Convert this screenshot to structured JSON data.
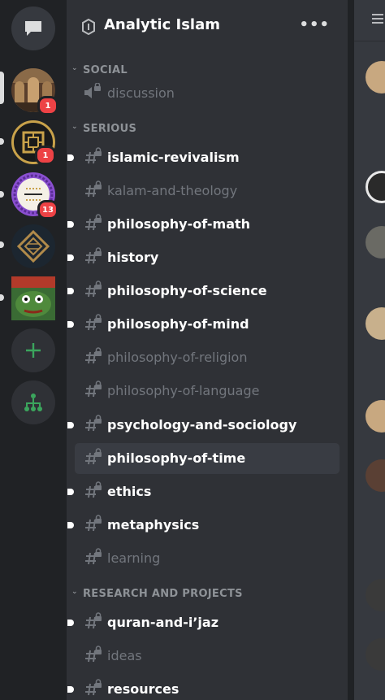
{
  "server": {
    "name": "Analytic Islam",
    "more_label": "•••"
  },
  "rail": {
    "badges": [
      "1",
      "1",
      "13"
    ],
    "icons": [
      "chat-bubble-icon",
      "add-server-icon",
      "explore-servers-icon"
    ]
  },
  "categories": [
    {
      "name": "SOCIAL"
    },
    {
      "name": "SERIOUS"
    },
    {
      "name": "RESEARCH AND PROJECTS"
    }
  ],
  "channels": [
    {
      "name": "discussion",
      "state": "muted",
      "icon": "speaker-lock-icon"
    },
    {
      "name": "islamic-revivalism",
      "state": "unread",
      "icon": "hash-lock-icon"
    },
    {
      "name": "kalam-and-theology",
      "state": "muted",
      "icon": "hash-lock-icon"
    },
    {
      "name": "philosophy-of-math",
      "state": "unread",
      "icon": "hash-lock-icon"
    },
    {
      "name": "history",
      "state": "unread",
      "icon": "hash-lock-icon"
    },
    {
      "name": "philosophy-of-science",
      "state": "unread",
      "icon": "hash-lock-icon"
    },
    {
      "name": "philosophy-of-mind",
      "state": "unread",
      "icon": "hash-lock-icon"
    },
    {
      "name": "philosophy-of-religion",
      "state": "muted",
      "icon": "hash-lock-icon"
    },
    {
      "name": "philosophy-of-language",
      "state": "muted",
      "icon": "hash-lock-icon"
    },
    {
      "name": "psychology-and-sociology",
      "state": "unread",
      "icon": "hash-lock-icon"
    },
    {
      "name": "philosophy-of-time",
      "state": "active",
      "icon": "hash-lock-icon"
    },
    {
      "name": "ethics",
      "state": "unread",
      "icon": "hash-lock-icon"
    },
    {
      "name": "metaphysics",
      "state": "unread",
      "icon": "hash-lock-icon"
    },
    {
      "name": "learning",
      "state": "muted",
      "icon": "hash-lock-icon"
    },
    {
      "name": "quran-and-i’jaz",
      "state": "unread",
      "icon": "hash-lock-icon"
    },
    {
      "name": "ideas",
      "state": "muted",
      "icon": "hash-lock-icon"
    },
    {
      "name": "resources",
      "state": "unread",
      "icon": "hash-lock-icon"
    }
  ],
  "colors": {
    "rail_bg": "#202225",
    "panel_bg": "#2f3136",
    "active_bg": "#393c43",
    "unread_text": "#ffffff",
    "muted_text": "#72767d",
    "badge": "#ed4245",
    "green": "#3ba55d"
  }
}
